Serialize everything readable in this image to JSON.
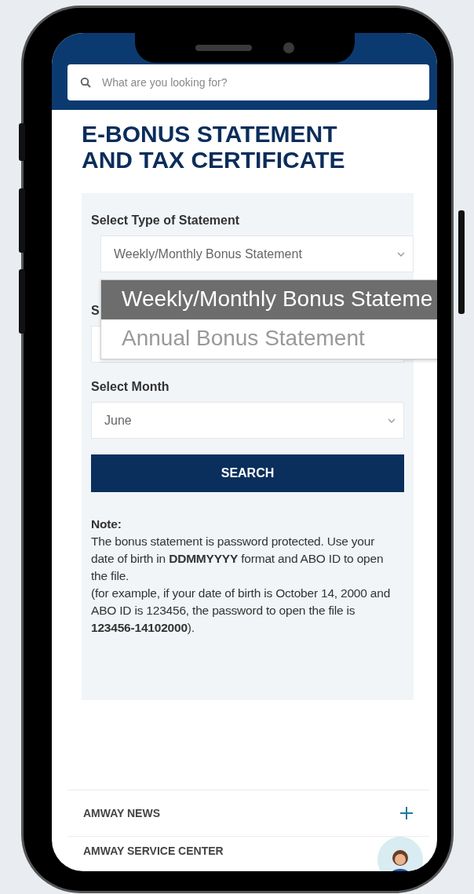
{
  "search": {
    "placeholder": "What are you looking for?"
  },
  "title": "E-BONUS STATEMENT AND TAX CERTIFICATE",
  "form": {
    "type_label": "Select Type of Statement",
    "type_value": "Weekly/Monthly Bonus Statement",
    "dropdown": [
      {
        "label": "Weekly/Monthly Bonus Stateme",
        "selected": true
      },
      {
        "label": "Annual Bonus Statement",
        "selected": false
      }
    ],
    "year_label": "S",
    "month_label": "Select Month",
    "month_value": "June",
    "button": "SEARCH"
  },
  "note": {
    "heading": "Note:",
    "paragraphs": [
      "The bonus statement is password protected. Use your date of birth in **DDMMYYYY** format and ABO ID to open the file.",
      "(for example, if your date of birth is October 14, 2000 and ABO ID is 123456, the password to open the file is **123456-14102000**)."
    ]
  },
  "footer": [
    {
      "label": "AMWAY NEWS",
      "expandable": true
    },
    {
      "label": "AMWAY SERVICE CENTER"
    }
  ]
}
